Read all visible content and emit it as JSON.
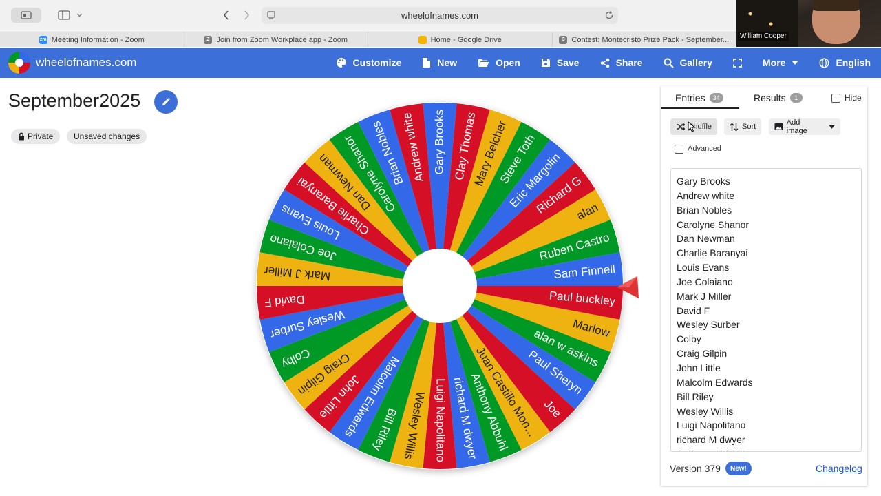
{
  "browser": {
    "url": "wheelofnames.com",
    "tabs": [
      {
        "label": "Meeting Information - Zoom",
        "fav": "zm",
        "color": "#2d8cff"
      },
      {
        "label": "Join from Zoom Workplace app - Zoom",
        "fav": "Z",
        "color": "#7a7a7a"
      },
      {
        "label": "Home - Google Drive",
        "fav": "",
        "color": "#f4b400"
      },
      {
        "label": "Contest: Montecristo Prize Pack - September...",
        "fav": "C",
        "color": "#7a7a7a"
      }
    ],
    "video_name": "William Cooper"
  },
  "app": {
    "brand": "wheelofnames.com",
    "menu": [
      "Customize",
      "New",
      "Open",
      "Save",
      "Share",
      "Gallery",
      "",
      "More",
      "English"
    ],
    "accent": "#3c6fd8"
  },
  "page": {
    "title": "September2025",
    "chips": [
      "Private",
      "Unsaved changes"
    ]
  },
  "wheel": {
    "colors": [
      "#3369e8",
      "#d50f25",
      "#eeb211",
      "#009925"
    ],
    "entries": [
      "Gary Brooks",
      "Clay Thomas",
      "Mary Belcher",
      "Steve Toth",
      "Eric Margolin",
      "Richard G",
      "alan",
      "Ruben Castro",
      "Sam Finnell",
      "Paul buckley",
      "Marlow",
      "alan w askins",
      "Paul Sheryn",
      "Joe",
      "Juan Castillo Mon...",
      "Anthony Abbuhl",
      "richard M dwyer",
      "Luigi Napolitano",
      "Wesley Willis",
      "Bill Riley",
      "Malcolm Edwards",
      "John Little",
      "Craig Gilpin",
      "Colby",
      "Wesley Surber",
      "David F",
      "Mark J Miller",
      "Joe Colaiano",
      "Louis Evans",
      "Charlie Baranyai",
      "Dan Newman",
      "Carolyne Shanor",
      "Brian Nobles",
      "Andrew white"
    ],
    "start_color_index": 0
  },
  "panel": {
    "tab_entries": "Entries",
    "entries_count": "34",
    "tab_results": "Results",
    "results_count": "1",
    "hide_label": "Hide",
    "shuffle": "Shuffle",
    "sort": "Sort",
    "add_image": "Add image",
    "advanced": "Advanced",
    "list": [
      "Gary Brooks",
      "Andrew white",
      "Brian Nobles",
      "Carolyne Shanor",
      "Dan Newman",
      "Charlie Baranyai",
      "Louis Evans",
      "Joe Colaiano",
      "Mark J Miller",
      "David F",
      "Wesley Surber",
      "Colby",
      "Craig Gilpin",
      "John Little",
      "Malcolm Edwards",
      "Bill Riley",
      "Wesley Willis",
      "Luigi Napolitano",
      "richard M dwyer",
      "Anthony Abbuhl"
    ],
    "version": "Version 379",
    "new_badge": "New!",
    "changelog": "Changelog"
  }
}
